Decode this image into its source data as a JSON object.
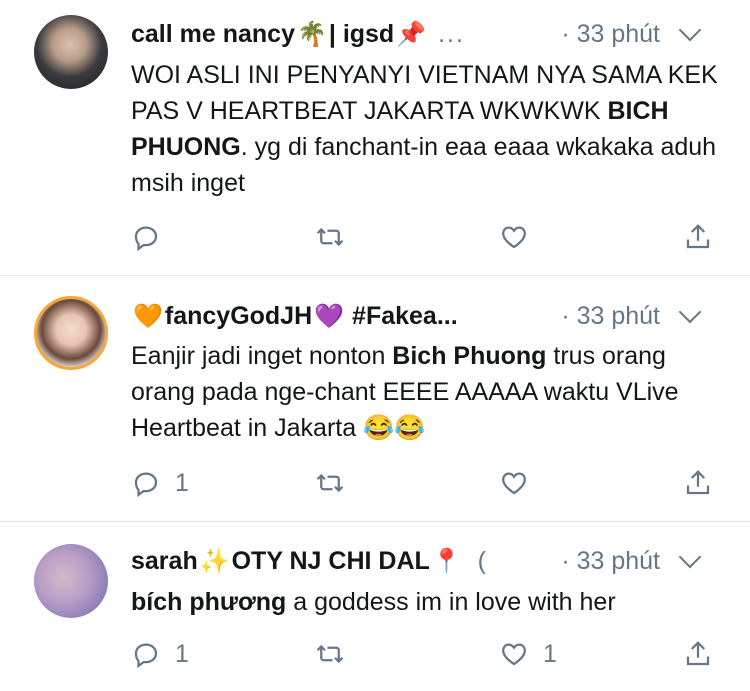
{
  "tweets": [
    {
      "name": "call me nancy",
      "name_emoji_1": "🌴",
      "name_suffix": "| igsd",
      "name_emoji_2": "📌",
      "more": "...",
      "time": "· 33 phút",
      "text_1": "WOI ASLI INI PENYANYI VIETNAM NYA SAMA KEK PAS V HEARTBEAT JAKARTA WKWKWK ",
      "text_bold": "BICH PHUONG",
      "text_2": ". yg di fanchant-in eaa eaaa wkakaka aduh msih inget",
      "reply_count": "",
      "like_count": ""
    },
    {
      "name_emoji_1": "🧡",
      "name": "fancyGodJH",
      "name_emoji_2": "💜",
      "name_suffix": "#Fakea...",
      "time": "· 33 phút",
      "text_1": "Eanjir jadi inget nonton ",
      "text_bold": "Bich Phuong",
      "text_2": " trus orang orang pada nge-chant EEEE AAAAA waktu VLive Heartbeat in Jakarta ",
      "text_emoji": "😂😂",
      "reply_count": "1",
      "like_count": ""
    },
    {
      "name": "sarah",
      "name_emoji_1": "✨",
      "name_suffix": "OTY NJ CHI DAL",
      "name_emoji_2": "📍",
      "more": "(",
      "time": "· 33 phút",
      "text_bold": "bích phương",
      "text_2": " a goddess im in love with her",
      "reply_count": "1",
      "like_count": "1"
    }
  ],
  "icons": [
    "reply-icon",
    "retweet-icon",
    "like-icon",
    "share-icon",
    "chevron-down-icon"
  ],
  "colors": {
    "meta": "#657786",
    "divider": "#e1e8ed",
    "text": "#14171a"
  }
}
